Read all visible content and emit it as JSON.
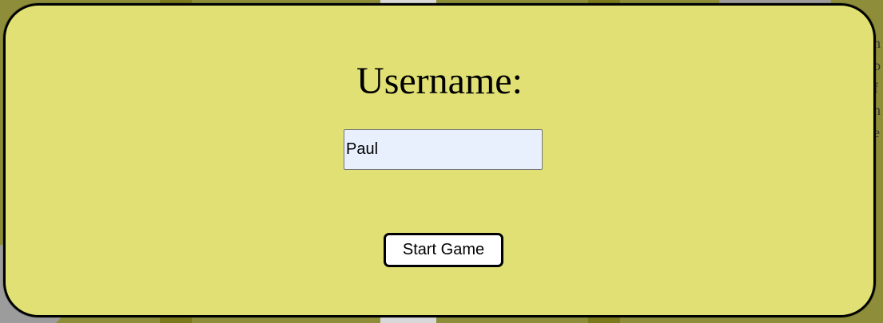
{
  "modal": {
    "title": "Username:",
    "username_value": "Paul",
    "start_button_label": "Start Game"
  },
  "background": {
    "partial_text": [
      "n",
      "o",
      "f",
      "n",
      "e"
    ]
  },
  "colors": {
    "modal_background": "#e1e074",
    "input_background": "#e8f0fe",
    "button_background": "#ffffff",
    "border": "#000000"
  }
}
